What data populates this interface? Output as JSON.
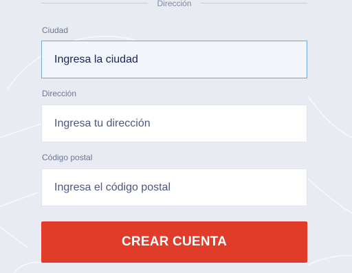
{
  "section": {
    "title": "Dirección"
  },
  "fields": [
    {
      "label": "Ciudad",
      "placeholder": "Ingresa la ciudad",
      "value": ""
    },
    {
      "label": "Dirección",
      "placeholder": "Ingresa tu dirección",
      "value": ""
    },
    {
      "label": "Código postal",
      "placeholder": "Ingresa el código postal",
      "value": ""
    }
  ],
  "submit": {
    "label": "CREAR CUENTA"
  },
  "colors": {
    "background": "#e9ebf3",
    "accent": "#e03c29",
    "focus_border": "#6fa7d4",
    "label_text": "#6d7594"
  }
}
